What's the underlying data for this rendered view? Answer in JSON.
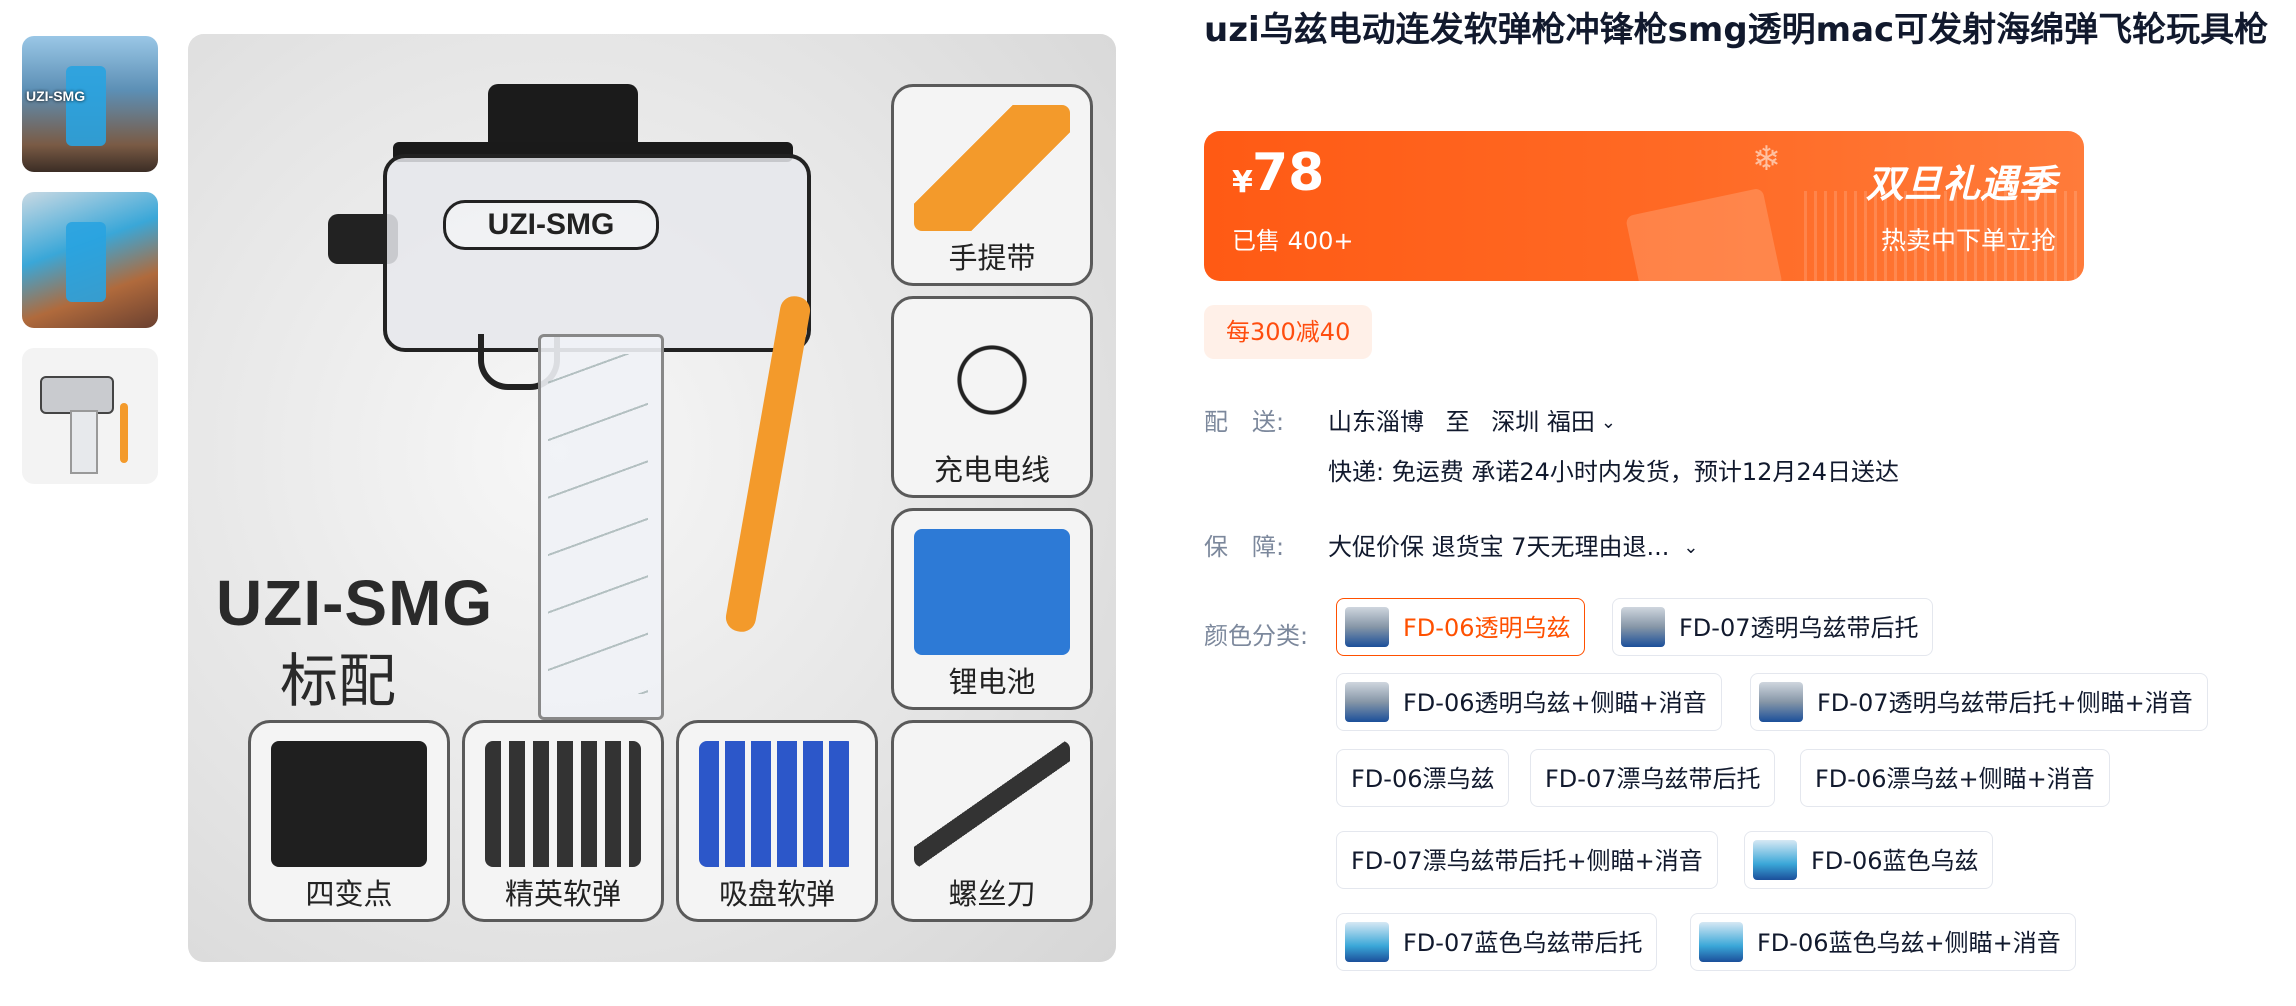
{
  "product": {
    "title": "uzi乌兹电动连发软弹枪冲锋枪smg透明mac可发射海绵弹飞轮玩具枪",
    "currency": "¥",
    "price": "78",
    "sold": "已售 400+",
    "promo_name": "双旦礼遇季",
    "promo_cta": "热卖中下单立抢",
    "coupon": "每300减40"
  },
  "gallery": {
    "thumb1_label": "UZI-SMG",
    "main": {
      "gun_logo": "UZI-SMG",
      "title": "UZI-SMG",
      "subtitle": "标配",
      "accessories": [
        "手提带",
        "充电电线",
        "锂电池",
        "四变点",
        "精英软弹",
        "吸盘软弹",
        "螺丝刀"
      ]
    }
  },
  "shipping": {
    "label": "配　送:",
    "from": "山东淄博",
    "to_word": "至",
    "to": "深圳 福田",
    "detail": "快递: 免运费  承诺24小时内发货，预计12月24日送达"
  },
  "guarantee": {
    "label": "保　障:",
    "text": "大促价保 退货宝 7天无理由退..."
  },
  "colors": {
    "label": "颜色分类:",
    "options": [
      "FD-06透明乌兹",
      "FD-07透明乌兹带后托",
      "FD-06透明乌兹+侧瞄+消音",
      "FD-07透明乌兹带后托+侧瞄+消音",
      "FD-06漂乌兹",
      "FD-07漂乌兹带后托",
      "FD-06漂乌兹+侧瞄+消音",
      "FD-07漂乌兹带后托+侧瞄+消音",
      "FD-06蓝色乌兹",
      "FD-07蓝色乌兹带后托",
      "FD-06蓝色乌兹+侧瞄+消音"
    ],
    "selected": "FD-06透明乌兹"
  },
  "colors_accent": "#ff5000",
  "banner_color": "#ff5a14",
  "icons": [
    "chevron-down-icon"
  ]
}
